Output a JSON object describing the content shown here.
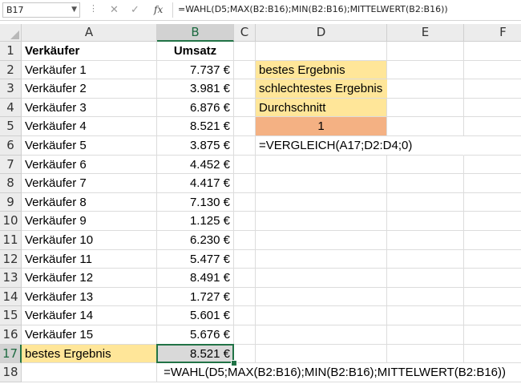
{
  "formula_bar": {
    "name_box": "B17",
    "fx_label": "fx",
    "formula": "=WAHL(D5;MAX(B2:B16);MIN(B2:B16);MITTELWERT(B2:B16))"
  },
  "columns": [
    "A",
    "B",
    "C",
    "D",
    "E",
    "F"
  ],
  "active_column": "B",
  "active_row": 17,
  "rows": [
    1,
    2,
    3,
    4,
    5,
    6,
    7,
    8,
    9,
    10,
    11,
    12,
    13,
    14,
    15,
    16,
    17,
    18
  ],
  "cells": {
    "A1": "Verkäufer",
    "B1": "Umsatz",
    "A2": "Verkäufer 1",
    "B2": "7.737 €",
    "A3": "Verkäufer 2",
    "B3": "3.981 €",
    "A4": "Verkäufer 3",
    "B4": "6.876 €",
    "A5": "Verkäufer 4",
    "B5": "8.521 €",
    "A6": "Verkäufer 5",
    "B6": "3.875 €",
    "A7": "Verkäufer 6",
    "B7": "4.452 €",
    "A8": "Verkäufer 7",
    "B8": "4.417 €",
    "A9": "Verkäufer 8",
    "B9": "7.130 €",
    "A10": "Verkäufer 9",
    "B10": "1.125 €",
    "A11": "Verkäufer 10",
    "B11": "6.230 €",
    "A12": "Verkäufer 11",
    "B12": "5.477 €",
    "A13": "Verkäufer 12",
    "B13": "8.491 €",
    "A14": "Verkäufer 13",
    "B14": "1.727 €",
    "A15": "Verkäufer 14",
    "B15": "5.601 €",
    "A16": "Verkäufer 15",
    "B16": "5.676 €",
    "A17": "bestes Ergebnis",
    "B17": "8.521 €",
    "B18": "=WAHL(D5;MAX(B2:B16);MIN(B2:B16);MITTELWERT(B2:B16))",
    "D2": "bestes Ergebnis",
    "D3": "schlechtestes Ergebnis",
    "D4": "Durchschnitt",
    "D5": "1",
    "D6": "=VERGLEICH(A17;D2:D4;0)"
  },
  "colors": {
    "highlight_yellow": "#ffe699",
    "highlight_orange": "#f4b183",
    "selection_green": "#217346"
  }
}
